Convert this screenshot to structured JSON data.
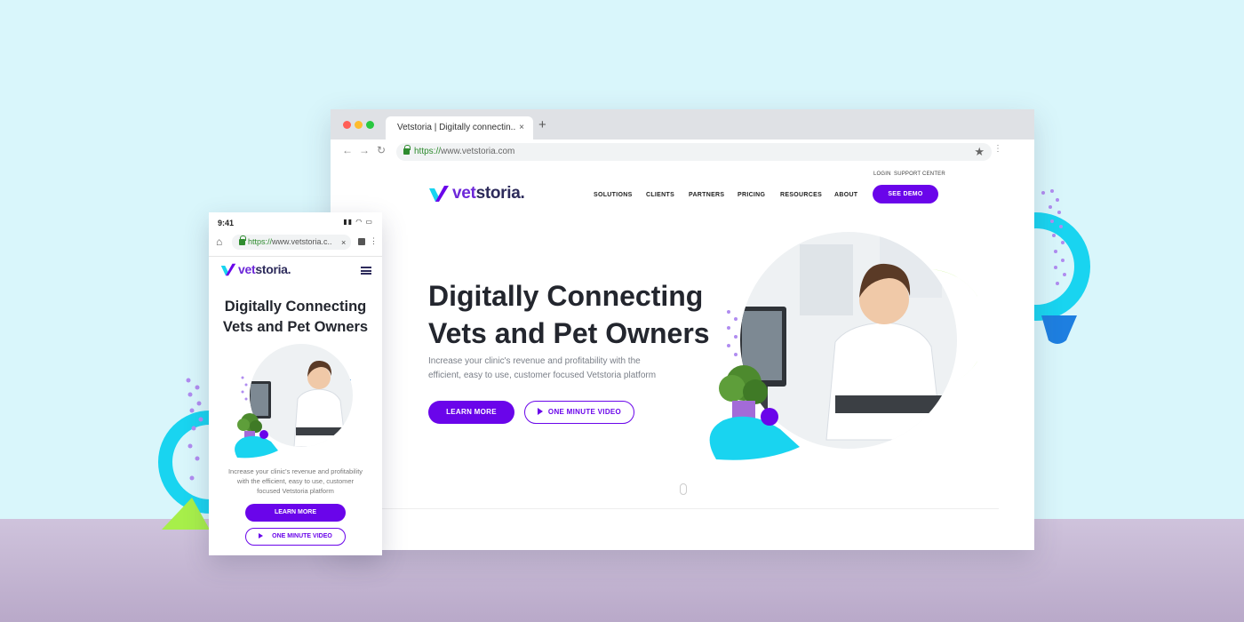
{
  "browser": {
    "tab_title": "Vetstoria | Digitally connectin..",
    "tab_close": "×",
    "new_tab": "+",
    "url_scheme": "https://",
    "url_host": "www.vetstoria.com"
  },
  "site": {
    "logo": {
      "v": "vet",
      "rest": "storia",
      "mark": "."
    },
    "utility": {
      "login": "LOGIN",
      "support": "SUPPORT CENTER"
    },
    "nav": [
      "SOLUTIONS",
      "CLIENTS",
      "PARTNERS",
      "PRICING",
      "RESOURCES",
      "ABOUT"
    ],
    "cta_demo": "SEE DEMO",
    "hero": {
      "title_line1": "Digitally Connecting",
      "title_line2": "Vets and Pet Owners",
      "subtitle_line1": "Increase your clinic's revenue and profitability with the",
      "subtitle_line2": "efficient, easy to use, customer focused Vetstoria platform",
      "learn_more": "LEARN MORE",
      "video": "ONE MINUTE VIDEO"
    }
  },
  "mobile": {
    "time": "9:41",
    "url": "https://www.vetstoria.c...",
    "url_scheme": "https://",
    "url_rest": "www.vetstoria.c..",
    "close": "×",
    "title_line1": "Digitally Connecting",
    "title_line2": "Vets and Pet Owners",
    "subtitle_line1": "Increase your clinic's revenue and profitability",
    "subtitle_line2": "with the efficient, easy to use, customer",
    "subtitle_line3": "focused Vetstoria platform",
    "learn_more": "LEARN MORE",
    "video": "ONE MINUTE VIDEO"
  },
  "colors": {
    "brand_purple": "#6a05ea",
    "accent_cyan": "#19d4f0",
    "accent_green": "#a7ef4a",
    "accent_blue": "#1e7fe0",
    "background": "#d9f6fb",
    "floor": "#c4b6d6"
  }
}
